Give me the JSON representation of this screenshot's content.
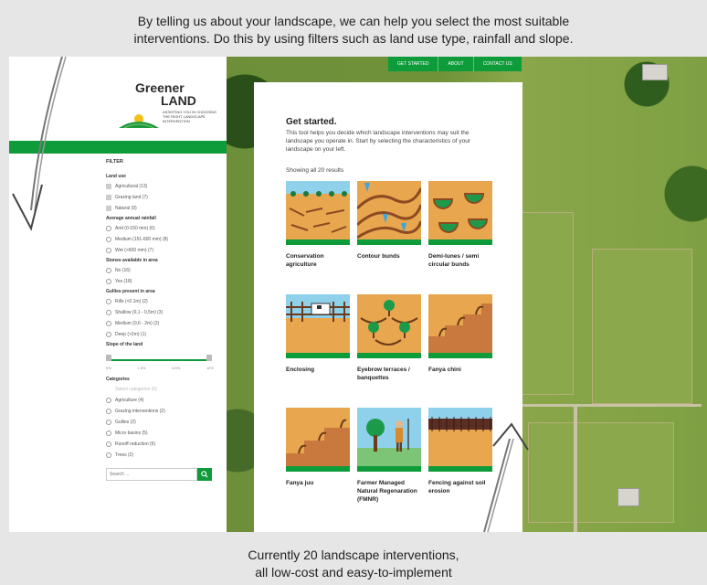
{
  "captions": {
    "top_line1": "By telling us about your landscape, we can help you select the most suitable",
    "top_line2": "interventions. Do this by using filters such as land use type, rainfall and slope.",
    "bottom_line1": "Currently 20 landscape interventions,",
    "bottom_line2": "all low-cost and easy-to-implement"
  },
  "logo": {
    "word1": "Greener",
    "word2": "LAND",
    "tagline": "ASSISTING YOU IN CHOOSING THE RIGHT LANDSCAPE INTERVENTION"
  },
  "nav": {
    "items": [
      "GET STARTED",
      "ABOUT",
      "CONTACT US"
    ]
  },
  "filter": {
    "title": "FILTER",
    "land_use": {
      "title": "Land use",
      "options": [
        "Agricultural (13)",
        "Grazing land (7)",
        "Natural (9)"
      ]
    },
    "rainfall": {
      "title": "Average annual rainfall",
      "options": [
        "Arid (0-150 mm) (6)",
        "Medium (151-600 mm) (8)",
        "Wet (>600 mm) (7)"
      ]
    },
    "stones": {
      "title": "Stones available in area",
      "options": [
        "No (16)",
        "Yes (18)"
      ]
    },
    "gullies": {
      "title": "Gullies present in area",
      "options": [
        "Rills (<0.1m) (2)",
        "Shallow (0,1 - 0,5m) (3)",
        "Medium (0,6 - 2m) (2)",
        "Deep (>2m) (1)"
      ]
    },
    "slope": {
      "title": "Slope of the land",
      "min_label": "0",
      "max_label": "12",
      "ticks": [
        "0%",
        "1.5%",
        "6.5%",
        "12%"
      ]
    },
    "categories": {
      "title": "Categories",
      "placeholder": "Select categories (0)",
      "options": [
        "Agriculture (4)",
        "Grazing interventions (2)",
        "Gullies (2)",
        "Micro basins (5)",
        "Runoff reduction (6)",
        "Trees (2)"
      ]
    },
    "search": {
      "placeholder": "Search ...",
      "icon": "search-icon"
    }
  },
  "main": {
    "title": "Get started.",
    "intro": "This tool helps you decide which landscape interventions may suit the landscape you operate in. Start by selecting the characteristics of your landscape on your left.",
    "results": "Showing all 20 results",
    "cards": [
      "Conservation agriculture",
      "Contour bunds",
      "Demi-lunes / semi circular bunds",
      "Enclosing",
      "Eyebrow terraces / banquettes",
      "Fanya chini",
      "Fanya juu",
      "Farmer Managed Natural Regenaration (FMNR)",
      "Fencing against soil erosion"
    ]
  },
  "colors": {
    "brand_green": "#0e9b3a",
    "soil_orange": "#e8a64e",
    "sky_blue": "#8fd0ea"
  }
}
